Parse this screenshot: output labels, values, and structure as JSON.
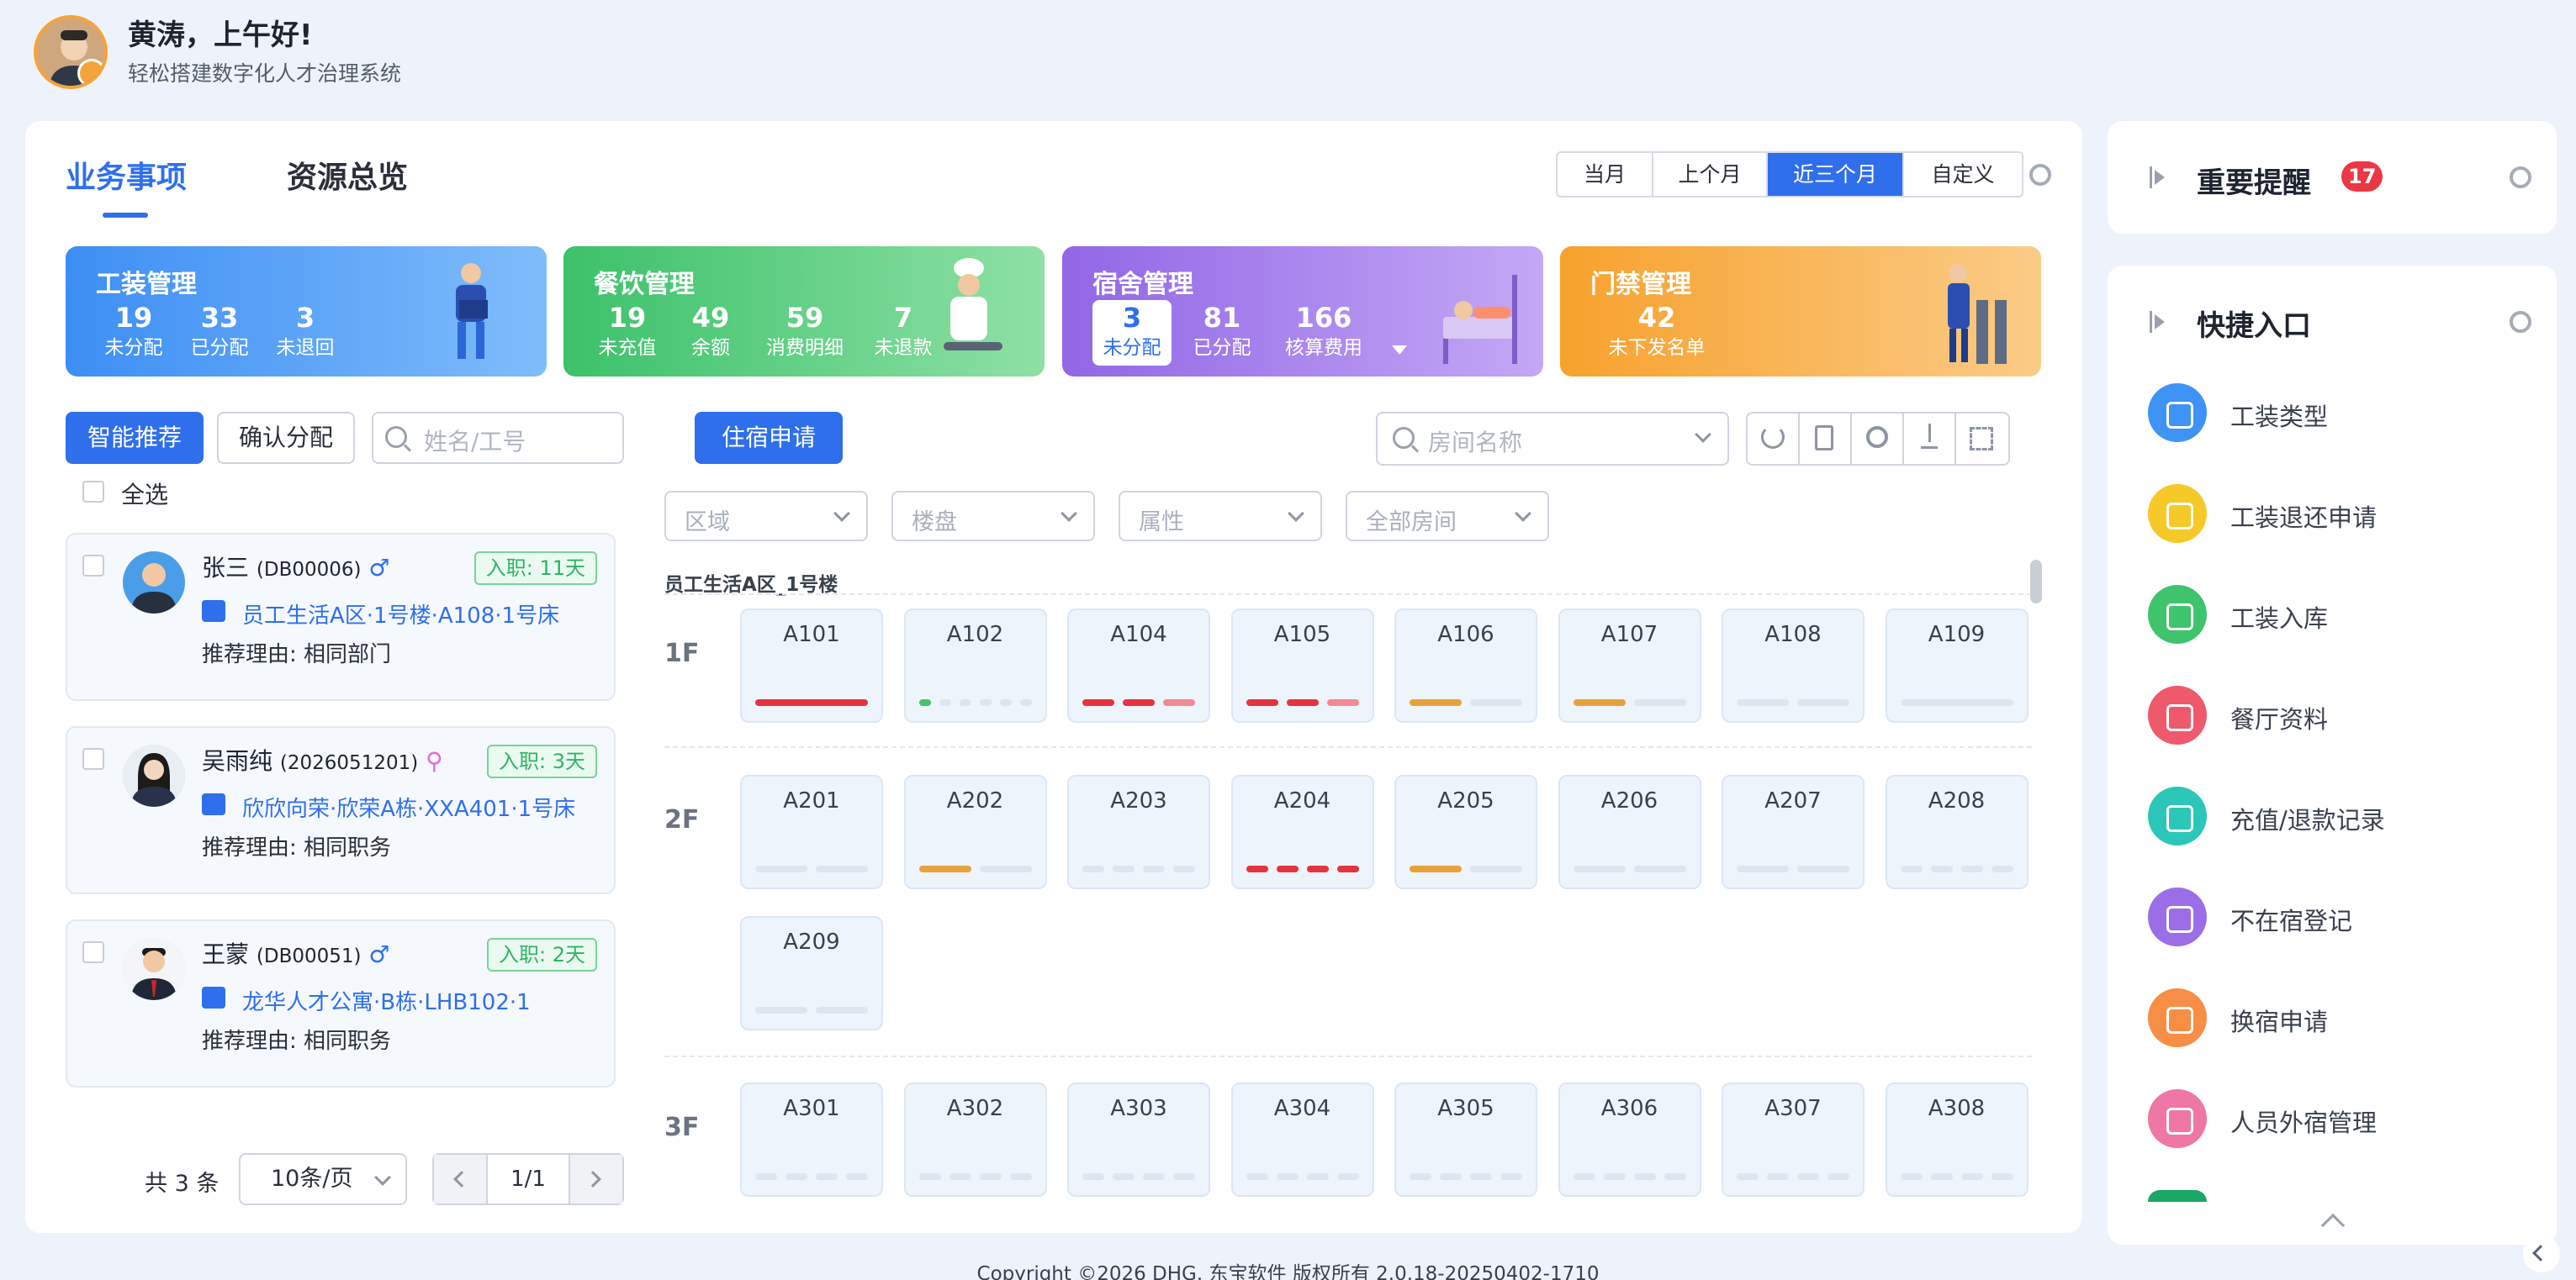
{
  "header": {
    "greeting": "黄涛，上午好!",
    "subtitle": "轻松搭建数字化人才治理系统"
  },
  "tabs": [
    {
      "label": "业务事项",
      "active": true
    },
    {
      "label": "资源总览",
      "active": false
    }
  ],
  "periods": [
    {
      "label": "当月"
    },
    {
      "label": "上个月"
    },
    {
      "label": "近三个月",
      "active": true
    },
    {
      "label": "自定义"
    }
  ],
  "cards": [
    {
      "title": "工装管理",
      "color": "#3f93f5",
      "stats": [
        {
          "n": "19",
          "l": "未分配"
        },
        {
          "n": "33",
          "l": "已分配"
        },
        {
          "n": "3",
          "l": "未退回"
        }
      ]
    },
    {
      "title": "餐饮管理",
      "color": "#3fc46d",
      "stats": [
        {
          "n": "19",
          "l": "未充值"
        },
        {
          "n": "49",
          "l": "余额"
        },
        {
          "n": "59",
          "l": "消费明细"
        },
        {
          "n": "7",
          "l": "未退款"
        }
      ]
    },
    {
      "title": "宿舍管理",
      "color": "#9b6ee8",
      "stats": [
        {
          "n": "3",
          "l": "未分配"
        },
        {
          "n": "81",
          "l": "已分配"
        },
        {
          "n": "166",
          "l": "核算费用"
        }
      ]
    },
    {
      "title": "门禁管理",
      "color": "#f7a536",
      "stats": [
        {
          "n": "42",
          "l": "未下发名单"
        }
      ]
    }
  ],
  "left": {
    "smart_btn": "智能推荐",
    "confirm_btn": "确认分配",
    "search_placeholder": "姓名/工号",
    "select_all": "全选",
    "people": [
      {
        "name": "张三",
        "id": "(DB00006)",
        "tag": "入职: 11天",
        "dorm": "员工生活A区·1号楼·A108·1号床",
        "reason": "推荐理由: 相同部门"
      },
      {
        "name": "吴雨纯",
        "id": "(2026051201)",
        "tag": "入职: 3天",
        "dorm": "欣欣向荣·欣荣A栋·XXA401·1号床",
        "reason": "推荐理由: 相同职务"
      },
      {
        "name": "王蒙",
        "id": "(DB00051)",
        "tag": "入职: 2天",
        "dorm": "龙华人才公寓·B栋·LHB102·1",
        "reason": "推荐理由: 相同职务"
      }
    ],
    "pager": {
      "total": "共 3 条",
      "size": "10条/页",
      "page": "1/1"
    }
  },
  "center": {
    "apply_btn": "住宿申请",
    "room_search_placeholder": "房间名称",
    "filters": [
      "区域",
      "楼盘",
      "属性",
      "全部房间"
    ],
    "building": "员工生活A区_1号楼",
    "floors": [
      {
        "label": "1F",
        "rooms": [
          {
            "name": "A101",
            "bars": [
              "#e53340"
            ]
          },
          {
            "name": "A102",
            "bars": [
              "#4ac26b",
              "#dfe5ee",
              "#dfe5ee",
              "#dfe5ee",
              "#dfe5ee",
              "#dfe5ee"
            ]
          },
          {
            "name": "A104",
            "bars": [
              "#e53340",
              "#e53340",
              "#f08a94"
            ]
          },
          {
            "name": "A105",
            "bars": [
              "#e53340",
              "#e53340",
              "#f08a94"
            ]
          },
          {
            "name": "A106",
            "bars": [
              "#e7a23c",
              "#dfe5ee"
            ]
          },
          {
            "name": "A107",
            "bars": [
              "#e7a23c",
              "#dfe5ee"
            ]
          },
          {
            "name": "A108",
            "bars": [
              "#dfe5ee",
              "#dfe5ee"
            ]
          },
          {
            "name": "A109",
            "bars": [
              "#dfe5ee"
            ]
          }
        ]
      },
      {
        "label": "2F",
        "rooms": [
          {
            "name": "A201",
            "bars": [
              "#dfe5ee",
              "#dfe5ee"
            ]
          },
          {
            "name": "A202",
            "bars": [
              "#e7a23c",
              "#dfe5ee"
            ]
          },
          {
            "name": "A203",
            "bars": [
              "#dfe5ee",
              "#dfe5ee",
              "#dfe5ee",
              "#dfe5ee"
            ]
          },
          {
            "name": "A204",
            "bars": [
              "#e53340",
              "#e53340",
              "#e53340",
              "#e53340"
            ]
          },
          {
            "name": "A205",
            "bars": [
              "#e7a23c",
              "#dfe5ee"
            ]
          },
          {
            "name": "A206",
            "bars": [
              "#dfe5ee",
              "#dfe5ee"
            ]
          },
          {
            "name": "A207",
            "bars": [
              "#dfe5ee",
              "#dfe5ee"
            ]
          },
          {
            "name": "A208",
            "bars": [
              "#dfe5ee",
              "#dfe5ee",
              "#dfe5ee",
              "#dfe5ee"
            ]
          },
          {
            "name": "A209",
            "bars": [
              "#dfe5ee",
              "#dfe5ee"
            ]
          }
        ]
      },
      {
        "label": "3F",
        "rooms": [
          {
            "name": "A301",
            "bars": [
              "#dfe5ee",
              "#dfe5ee",
              "#dfe5ee",
              "#dfe5ee"
            ]
          },
          {
            "name": "A302",
            "bars": [
              "#dfe5ee",
              "#dfe5ee",
              "#dfe5ee",
              "#dfe5ee"
            ]
          },
          {
            "name": "A303",
            "bars": [
              "#dfe5ee",
              "#dfe5ee",
              "#dfe5ee",
              "#dfe5ee"
            ]
          },
          {
            "name": "A304",
            "bars": [
              "#dfe5ee",
              "#dfe5ee",
              "#dfe5ee",
              "#dfe5ee"
            ]
          },
          {
            "name": "A305",
            "bars": [
              "#dfe5ee",
              "#dfe5ee",
              "#dfe5ee",
              "#dfe5ee"
            ]
          },
          {
            "name": "A306",
            "bars": [
              "#dfe5ee",
              "#dfe5ee",
              "#dfe5ee",
              "#dfe5ee"
            ]
          },
          {
            "name": "A307",
            "bars": [
              "#dfe5ee",
              "#dfe5ee",
              "#dfe5ee",
              "#dfe5ee"
            ]
          },
          {
            "name": "A308",
            "bars": [
              "#dfe5ee",
              "#dfe5ee",
              "#dfe5ee",
              "#dfe5ee"
            ]
          }
        ]
      }
    ]
  },
  "reminder": {
    "title": "重要提醒",
    "count": "17"
  },
  "quick": {
    "title": "快捷入口",
    "items": [
      {
        "label": "工装类型",
        "color": "#3f93f5",
        "icon": "shirt-icon"
      },
      {
        "label": "工装退还申请",
        "color": "#f5c927",
        "icon": "list-icon"
      },
      {
        "label": "工装入库",
        "color": "#3fc46d",
        "icon": "inbound-icon"
      },
      {
        "label": "餐厅资料",
        "color": "#ee5a6c",
        "icon": "bell-dish-icon"
      },
      {
        "label": "充值/退款记录",
        "color": "#2cc7b8",
        "icon": "yen-icon"
      },
      {
        "label": "不在宿登记",
        "color": "#9b6ee8",
        "icon": "form-plus-icon"
      },
      {
        "label": "换宿申请",
        "color": "#f78e45",
        "icon": "house-icon"
      },
      {
        "label": "人员外宿管理",
        "color": "#ee77a6",
        "icon": "people-icon"
      }
    ]
  },
  "footer": "Copyright ©2026 DHG. 东宝软件 版权所有 2.0.18-20250402-1710"
}
